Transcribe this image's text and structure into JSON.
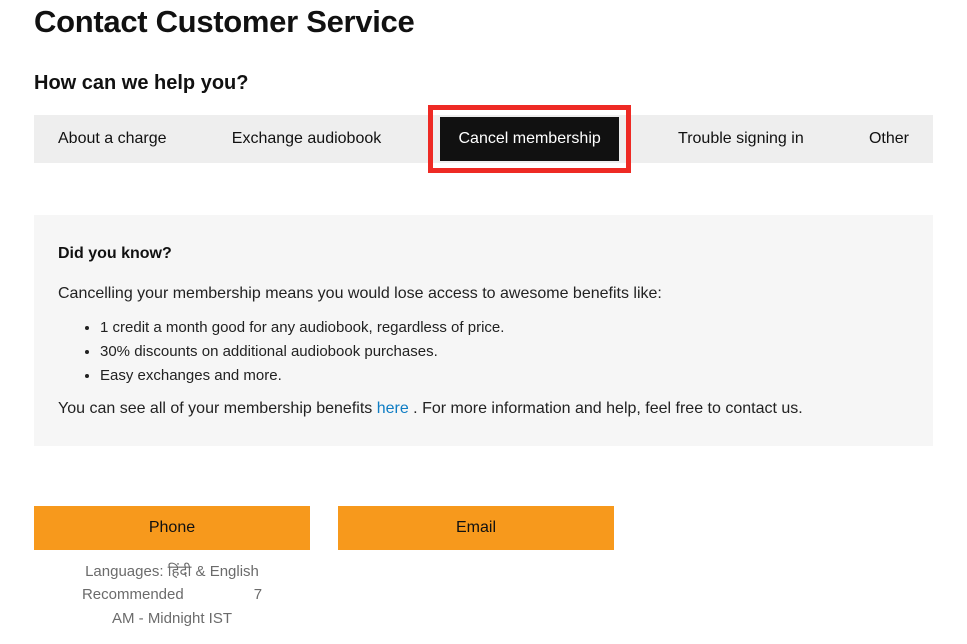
{
  "page_title": "Contact Customer Service",
  "help_heading": "How can we help you?",
  "tabs": {
    "about_charge": "About a charge",
    "exchange_audiobook": "Exchange audiobook",
    "cancel_membership": "Cancel membership",
    "trouble_signing_in": "Trouble signing in",
    "other": "Other"
  },
  "info_panel": {
    "heading": "Did you know?",
    "intro": "Cancelling your membership means you would lose access to awesome benefits like:",
    "benefits": {
      "b0": "1 credit a month good for any audiobook, regardless of price.",
      "b1": "30% discounts on additional audiobook purchases.",
      "b2": "Easy exchanges and more."
    },
    "footer_pre": "You can see all of your membership benefits ",
    "footer_link": "here",
    "footer_post": " . For more information and help, feel free to contact us."
  },
  "contact": {
    "phone_label": "Phone",
    "email_label": "Email",
    "phone_details": {
      "line1": "Languages: हिंदी & English",
      "line2_left": "Recommended",
      "line2_right": "7",
      "line3": "AM - Midnight IST"
    }
  }
}
